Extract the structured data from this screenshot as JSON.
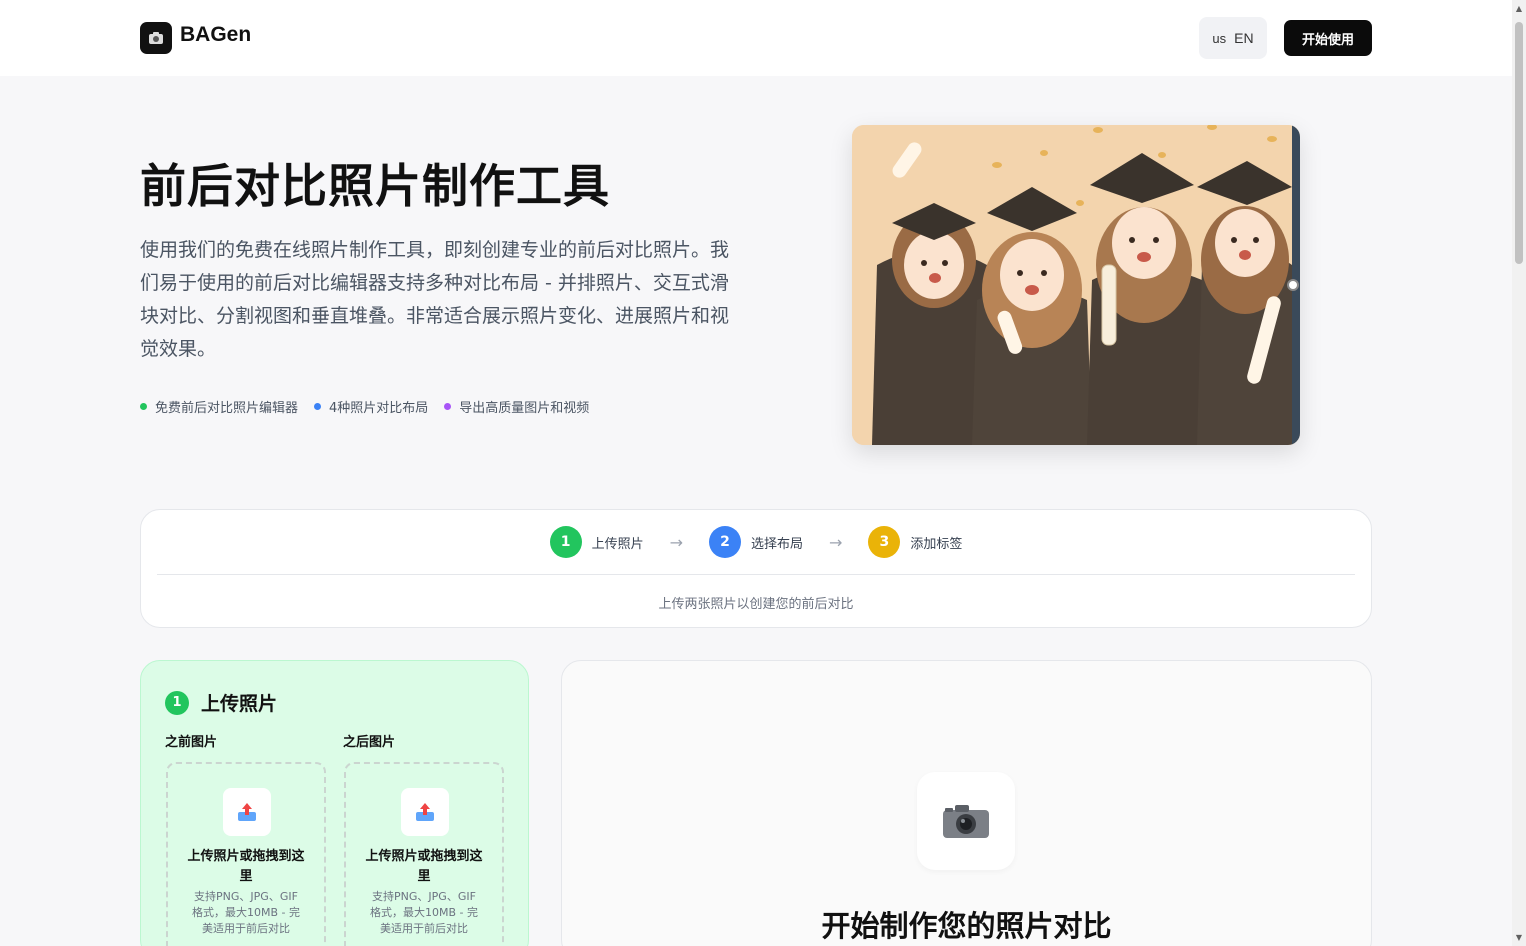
{
  "header": {
    "logo_icon": "camera-icon",
    "brand": "BAGen",
    "lang_flag": "us",
    "lang_label": "EN",
    "start_label": "开始使用"
  },
  "hero": {
    "title": "前后对比照片制作工具",
    "description": "使用我们的免费在线照片制作工具，即刻创建专业的前后对比照片。我们易于使用的前后对比编辑器支持多种对比布局 - 并排照片、交互式滑块对比、分割视图和垂直堆叠。非常适合展示照片变化、进展照片和视觉效果。",
    "features": [
      {
        "label": "免费前后对比照片编辑器",
        "color": "#22c55e"
      },
      {
        "label": "4种照片对比布局",
        "color": "#3b82f6"
      },
      {
        "label": "导出高质量图片和视频",
        "color": "#a855f7"
      }
    ]
  },
  "steps": {
    "items": [
      {
        "num": "1",
        "label": "上传照片",
        "color": "#22c55e"
      },
      {
        "num": "2",
        "label": "选择布局",
        "color": "#3b82f6"
      },
      {
        "num": "3",
        "label": "添加标签",
        "color": "#eab308"
      }
    ],
    "arrow": "→",
    "hint": "上传两张照片以创建您的前后对比"
  },
  "upload": {
    "step_num": "1",
    "title": "上传照片",
    "before_label": "之前图片",
    "after_label": "之后图片",
    "drop_title": "上传照片或拖拽到这里",
    "drop_sub": "支持PNG、JPG、GIF格式，最大10MB - 完美适用于前后对比"
  },
  "preview": {
    "icon": "camera-icon",
    "title": "开始制作您的照片对比"
  },
  "colors": {
    "accent_dark": "#0b0b0b",
    "upload_bg": "#dcfce7"
  }
}
